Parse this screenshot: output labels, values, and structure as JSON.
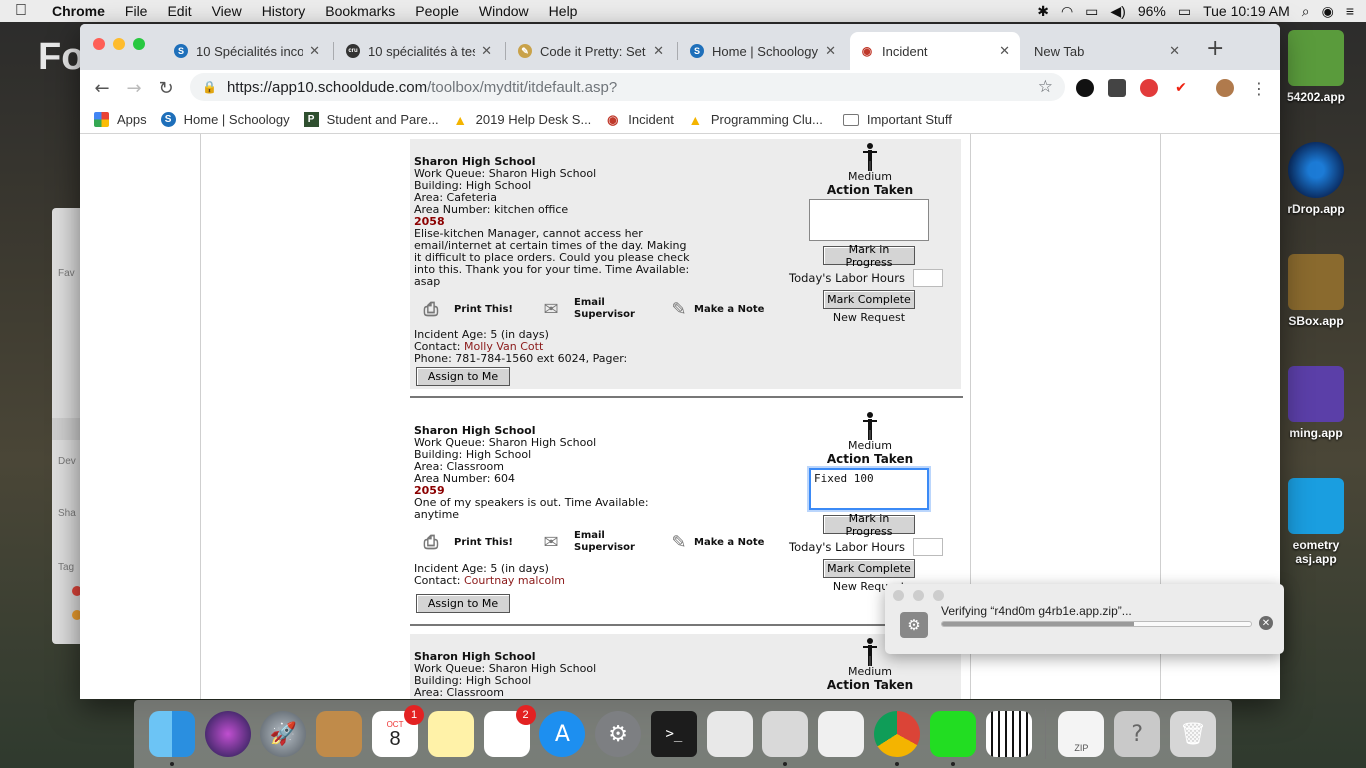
{
  "menubar": {
    "app_name": "Chrome",
    "items": [
      "File",
      "Edit",
      "View",
      "History",
      "Bookmarks",
      "People",
      "Window",
      "Help"
    ],
    "battery": "96%",
    "clock": "Tue 10:19 AM"
  },
  "desktop": {
    "icons": [
      {
        "label": "54202.app",
        "color": "#5a9b3c"
      },
      {
        "label": "rDrop.app",
        "color": "#1c7bd6"
      },
      {
        "label": "SBox.app",
        "color": "#8a6a2e"
      },
      {
        "label": "ming.app",
        "color": "#5b3fa8"
      },
      {
        "label": "eometry",
        "label2": "asj.app",
        "color": "#1a9ee0"
      }
    ],
    "left_text": "Fo"
  },
  "tabs": [
    {
      "title": "10 Spécialités inco",
      "favicon": "S",
      "fav_color": "#1e6fba"
    },
    {
      "title": "10 spécialités à tes",
      "favicon": "cru",
      "fav_color": "#333333"
    },
    {
      "title": "Code it Pretty: Set",
      "favicon": "✎",
      "fav_color": "#c9a24a"
    },
    {
      "title": "Home | Schoology",
      "favicon": "S",
      "fav_color": "#1e6fba"
    },
    {
      "title": "Incident",
      "favicon": "◉",
      "fav_color": "#c0392b"
    },
    {
      "title": "New Tab",
      "favicon": "",
      "fav_color": ""
    }
  ],
  "omnibox": {
    "host": "https://app10.schooldude.com",
    "path": "/toolbox/mydtit/itdefault.asp?"
  },
  "bookmarks": [
    {
      "label": "Apps",
      "icon": "grid-icon",
      "color": "#e94235"
    },
    {
      "label": "Home | Schoology",
      "icon": "S",
      "color": "#1e6fba"
    },
    {
      "label": "Student and Pare...",
      "icon": "P",
      "color": "#2f4f2f"
    },
    {
      "label": "2019 Help Desk S...",
      "icon": "▲",
      "color": "#f4b400"
    },
    {
      "label": "Incident",
      "icon": "◉",
      "color": "#c0392b"
    },
    {
      "label": "Programming Clu...",
      "icon": "▲",
      "color": "#f4b400"
    },
    {
      "label": "Important Stuff",
      "icon": "folder-icon",
      "color": "#777777"
    }
  ],
  "incidents": [
    {
      "school": "Sharon High School",
      "work_queue": "Work Queue: Sharon High School",
      "building": "Building: High School",
      "area": "Area: Cafeteria",
      "area_number": "Area Number: kitchen office",
      "number": "2058",
      "description": "Elise-kitchen Manager, cannot access her email/internet at certain times of the day. Making it difficult to place orders. Could you please check into this. Thank you for your time. Time Available: asap",
      "age": "Incident Age: 5 (in days)",
      "contact_label": "Contact: ",
      "contact_name": "Molly Van Cott",
      "phone": "Phone: 781-784-1560 ext 6024, Pager:",
      "priority": "Medium",
      "action_taken_label": "Action Taken",
      "action_taken_value": "",
      "labor_label": "Today's Labor Hours",
      "status": "New Request"
    },
    {
      "school": "Sharon High School",
      "work_queue": "Work Queue: Sharon High School",
      "building": "Building: High School",
      "area": "Area: Classroom",
      "area_number": "Area Number: 604",
      "number": "2059",
      "description": "One of my speakers is out. Time Available: anytime",
      "age": "Incident Age: 5 (in days)",
      "contact_label": "Contact: ",
      "contact_name": "Courtnay malcolm",
      "phone": "",
      "priority": "Medium",
      "action_taken_label": "Action Taken",
      "action_taken_value": "Fixed 100",
      "labor_label": "Today's Labor Hours",
      "status": "New Request"
    },
    {
      "school": "Sharon High School",
      "work_queue": "Work Queue: Sharon High School",
      "building": "Building: High School",
      "area": "Area: Classroom",
      "priority": "Medium",
      "action_taken_label": "Action Taken"
    }
  ],
  "actions": {
    "print": "Print This!",
    "email_1": "Email",
    "email_2": "Supervisor",
    "note": "Make a Note",
    "mark_progress": "Mark in Progress",
    "mark_complete": "Mark Complete",
    "assign": "Assign to Me"
  },
  "download": {
    "text": "Verifying “r4nd0m g4rb1e.app.zip”...",
    "progress": 0.62
  },
  "dock": {
    "calendar_month": "OCT",
    "calendar_day": "8",
    "calendar_badge": "1",
    "reminders_badge": "2",
    "zip_label": "ZIP"
  }
}
